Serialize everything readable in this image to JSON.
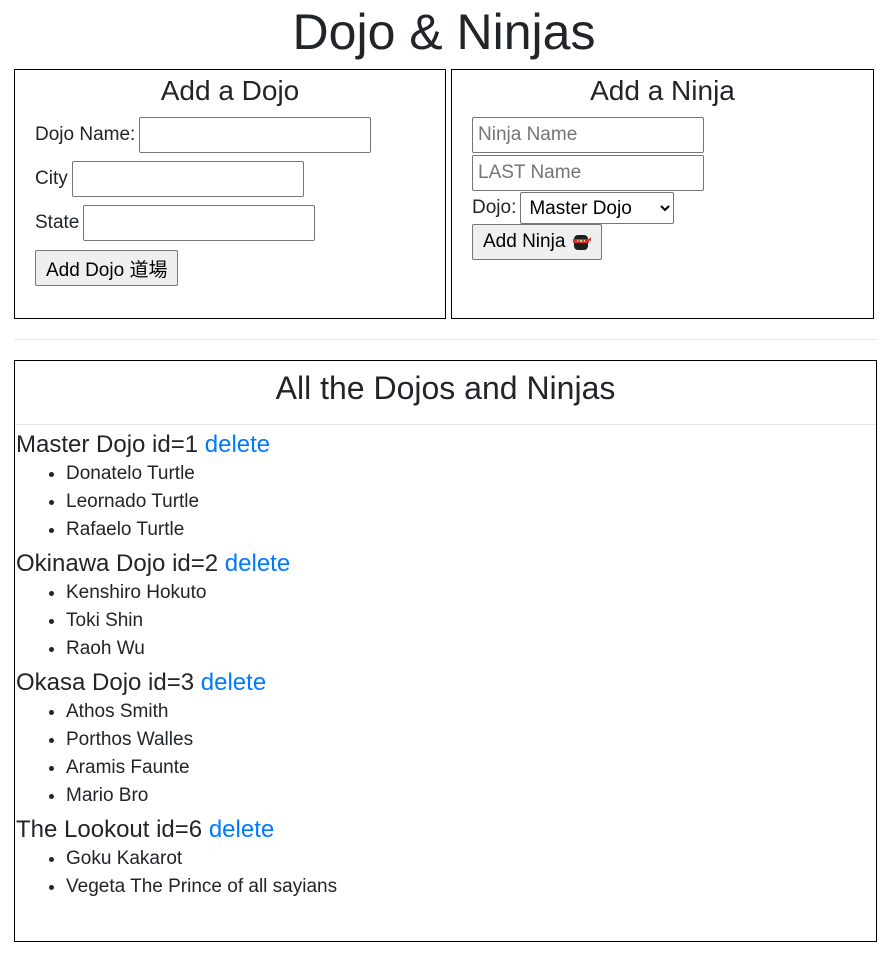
{
  "page": {
    "title": "Dojo & Ninjas"
  },
  "add_dojo": {
    "title": "Add a Dojo",
    "name_label": "Dojo Name:",
    "name_value": "",
    "city_label": "City",
    "city_value": "",
    "state_label": "State",
    "state_value": "",
    "submit_label": "Add Dojo 道場"
  },
  "add_ninja": {
    "title": "Add a Ninja",
    "first_placeholder": "Ninja Name",
    "last_placeholder": "LAST Name",
    "dojo_label": "Dojo:",
    "dojo_selected": "Master Dojo",
    "submit_label": "Add Ninja"
  },
  "list": {
    "title": "All the Dojos and Ninjas",
    "delete_label": "delete",
    "dojos": [
      {
        "heading": "Master Dojo id=1",
        "ninjas": [
          "Donatelo Turtle",
          "Leornado Turtle",
          "Rafaelo Turtle"
        ]
      },
      {
        "heading": "Okinawa Dojo id=2",
        "ninjas": [
          "Kenshiro Hokuto",
          "Toki Shin",
          "Raoh Wu"
        ]
      },
      {
        "heading": "Okasa Dojo id=3",
        "ninjas": [
          "Athos Smith",
          "Porthos Walles",
          "Aramis Faunte",
          "Mario Bro"
        ]
      },
      {
        "heading": "The Lookout id=6",
        "ninjas": [
          "Goku Kakarot",
          "Vegeta The Prince of all sayians"
        ]
      }
    ]
  },
  "colors": {
    "link": "#007bff",
    "text": "#212529"
  },
  "icons": {
    "ninja_button_icon": "ninja-icon"
  }
}
